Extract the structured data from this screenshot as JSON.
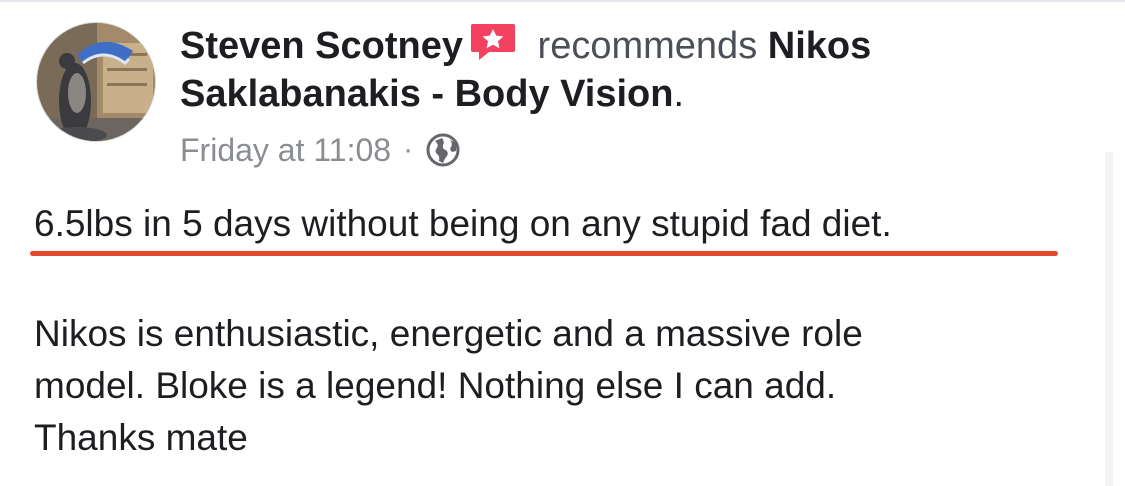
{
  "post": {
    "author": "Steven Scotney",
    "verb": " recommends ",
    "page_name_line1": "Nikos",
    "page_name_line2": "Saklabanakis - Body Vision",
    "period": ".",
    "timestamp": "Friday at 11:08",
    "separator": "·",
    "privacy_icon": "globe-icon",
    "recommend_icon": "recommendation-star-icon",
    "highlight": "6.5lbs in 5 days without being on any stupid fad diet.",
    "body_lines": [
      "Nikos is enthusiastic, energetic and a massive role",
      "model. Bloke is a legend! Nothing else I can add.",
      "Thanks mate"
    ]
  },
  "colors": {
    "underline": "#e3492c",
    "badge": "#f3425f",
    "meta_text": "#8a8d91"
  }
}
